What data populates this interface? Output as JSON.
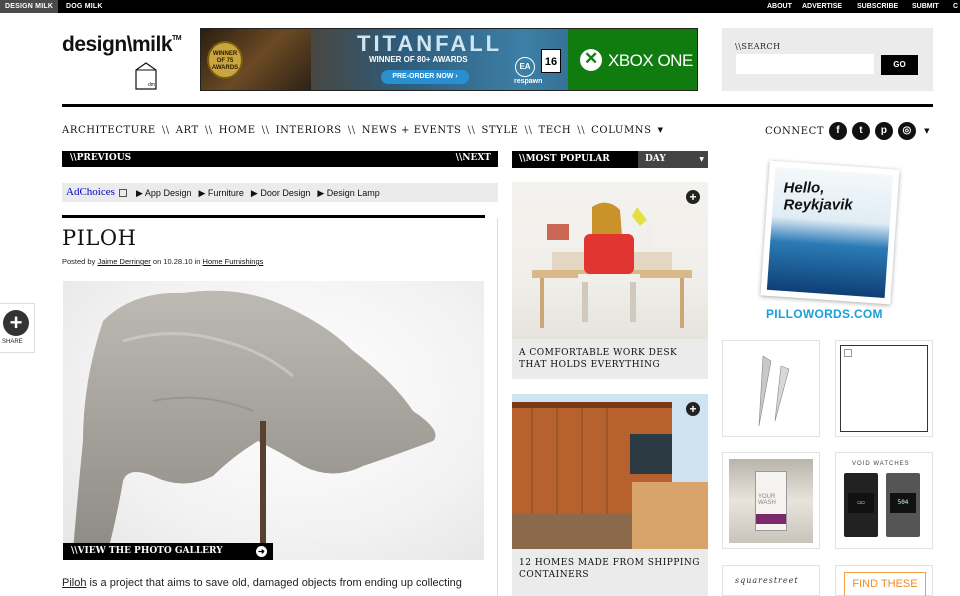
{
  "topbar": {
    "tabs": [
      "DESIGN MILK",
      "DOG MILK"
    ],
    "links": [
      "ABOUT",
      "ADVERTISE",
      "SUBSCRIBE",
      "SUBMIT",
      "C"
    ]
  },
  "logo": {
    "text": "design\\milk",
    "tm": "TM",
    "carton": "dm"
  },
  "ad": {
    "badge": "WINNER OF 75 AWARDS",
    "title": "TITANFALL",
    "subtitle": "WINNER OF 80+ AWARDS",
    "cta": "PRE-ORDER NOW ›",
    "ea": "EA",
    "rating": "16",
    "studio": "respawn",
    "platform": "XBOX ONE"
  },
  "search": {
    "label": "\\\\SEARCH",
    "placeholder": "",
    "button": "GO"
  },
  "nav": {
    "items": [
      "ARCHITECTURE",
      "ART",
      "HOME",
      "INTERIORS",
      "NEWS + EVENTS",
      "STYLE",
      "TECH",
      "COLUMNS"
    ],
    "separator": "\\\\",
    "connect": "CONNECT",
    "social": [
      "f",
      "t",
      "p",
      "◎"
    ]
  },
  "prevnext": {
    "previous": "\\\\PREVIOUS",
    "next": "\\\\NEXT"
  },
  "adchoices": {
    "label": "AdChoices",
    "links": [
      "▶ App Design",
      "▶ Furniture",
      "▶ Door Design",
      "▶ Design Lamp"
    ]
  },
  "article": {
    "title": "PILOH",
    "byline_prefix": "Posted by",
    "author": "Jaime Derringer",
    "byline_on": "on 10.28.10 in",
    "category": "Home Furnishings",
    "gallery_label": "\\\\VIEW THE PHOTO GALLERY",
    "para_link": "Piloh",
    "para_rest": " is a project that aims to save old, damaged objects from ending up collecting"
  },
  "share": {
    "label": "SHARE"
  },
  "popular": {
    "label": "\\\\MOST POPULAR",
    "period": "DAY",
    "cards": [
      {
        "caption": "A COMFORTABLE WORK DESK THAT HOLDS EVERYTHING"
      },
      {
        "caption": "12 HOMES MADE FROM SHIPPING CONTAINERS"
      }
    ]
  },
  "sidebar": {
    "pillow_text": "Hello, Reykjavik",
    "pillowords": "PILLOWORDS.COM",
    "void_label": "VOID WATCHES",
    "watch_face": "504",
    "pack_label": "YOUR WASH",
    "squarestreet": "squarestreet",
    "find": "FIND THESE"
  }
}
